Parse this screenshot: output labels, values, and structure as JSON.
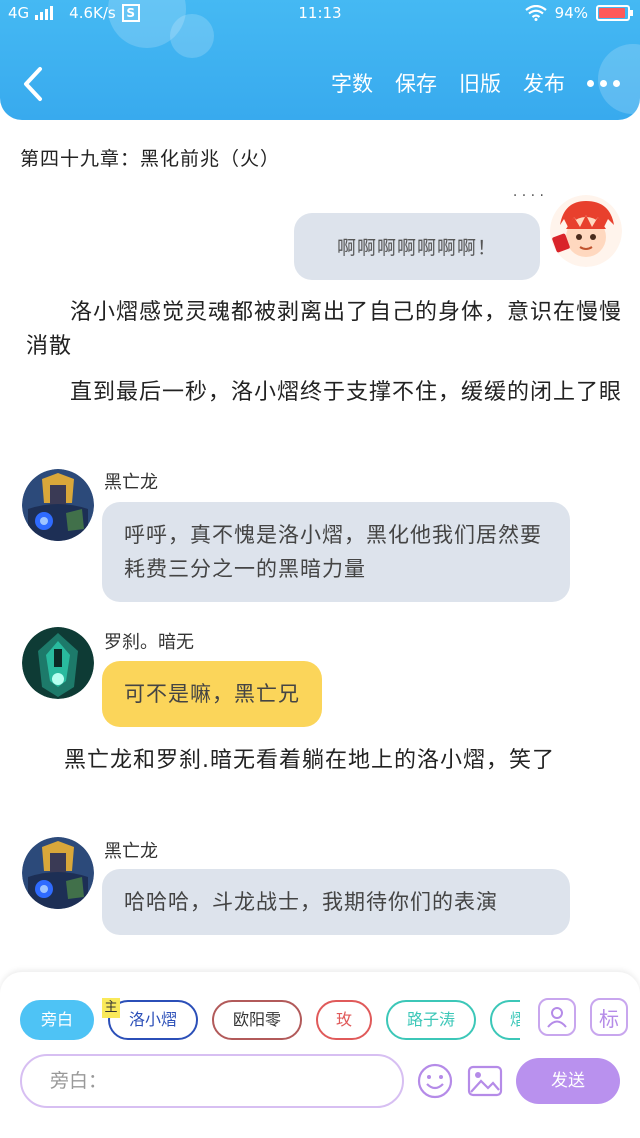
{
  "status_bar": {
    "network": "4G",
    "speed": "4.6K/s",
    "speed_icon": "S",
    "time": "11:13",
    "battery": "94%",
    "battery_level": 0.94
  },
  "header": {
    "actions": [
      "字数",
      "保存",
      "旧版",
      "发布"
    ]
  },
  "chapter_title": "第四十九章：黑化前兆（火）",
  "messages": {
    "right_bubble": "啊啊啊啊啊啊啊！",
    "narration_1": "洛小熠感觉灵魂都被剥离出了自己的身体，意识在慢慢消散",
    "narration_2": "直到最后一秒，洛小熠终于支撑不住，缓缓的闭上了眼",
    "heiwanglong_1": {
      "name": "黑亡龙",
      "text": "呼呼，真不愧是洛小熠，黑化他我们居然要耗费三分之一的黑暗力量"
    },
    "luosha": {
      "name": "罗刹。暗无",
      "text": "可不是嘛，黑亡兄"
    },
    "narration_3": "黑亡龙和罗刹.暗无看着躺在地上的洛小熠，笑了",
    "heiwanglong_2": {
      "name": "黑亡龙",
      "text": "哈哈哈，斗龙战士，我期待你们的表演"
    }
  },
  "chips": [
    {
      "label": "旁白"
    },
    {
      "label": "洛小熠"
    },
    {
      "label": "欧阳零"
    },
    {
      "label": "玫"
    },
    {
      "label": "路子涛"
    },
    {
      "label": "熠"
    }
  ],
  "zhu_badge": "主",
  "biao_label": "标",
  "input": {
    "placeholder": "旁白："
  },
  "send_label": "发送",
  "colors": {
    "header": "#3eb1f0",
    "bubble": "#dde3ec",
    "yellow_bubble": "#fbd55a",
    "send": "#b991ee",
    "chip_narrator": "#4ec3f5",
    "chip_main": "#2b4fb8",
    "chip_ouyang": "#b25a5a",
    "chip_mei": "#e05a5a",
    "chip_lu": "#3cc7b8"
  },
  "icons": [
    "back-icon",
    "more-icon",
    "character-card-icon",
    "emoji-icon",
    "image-icon"
  ]
}
